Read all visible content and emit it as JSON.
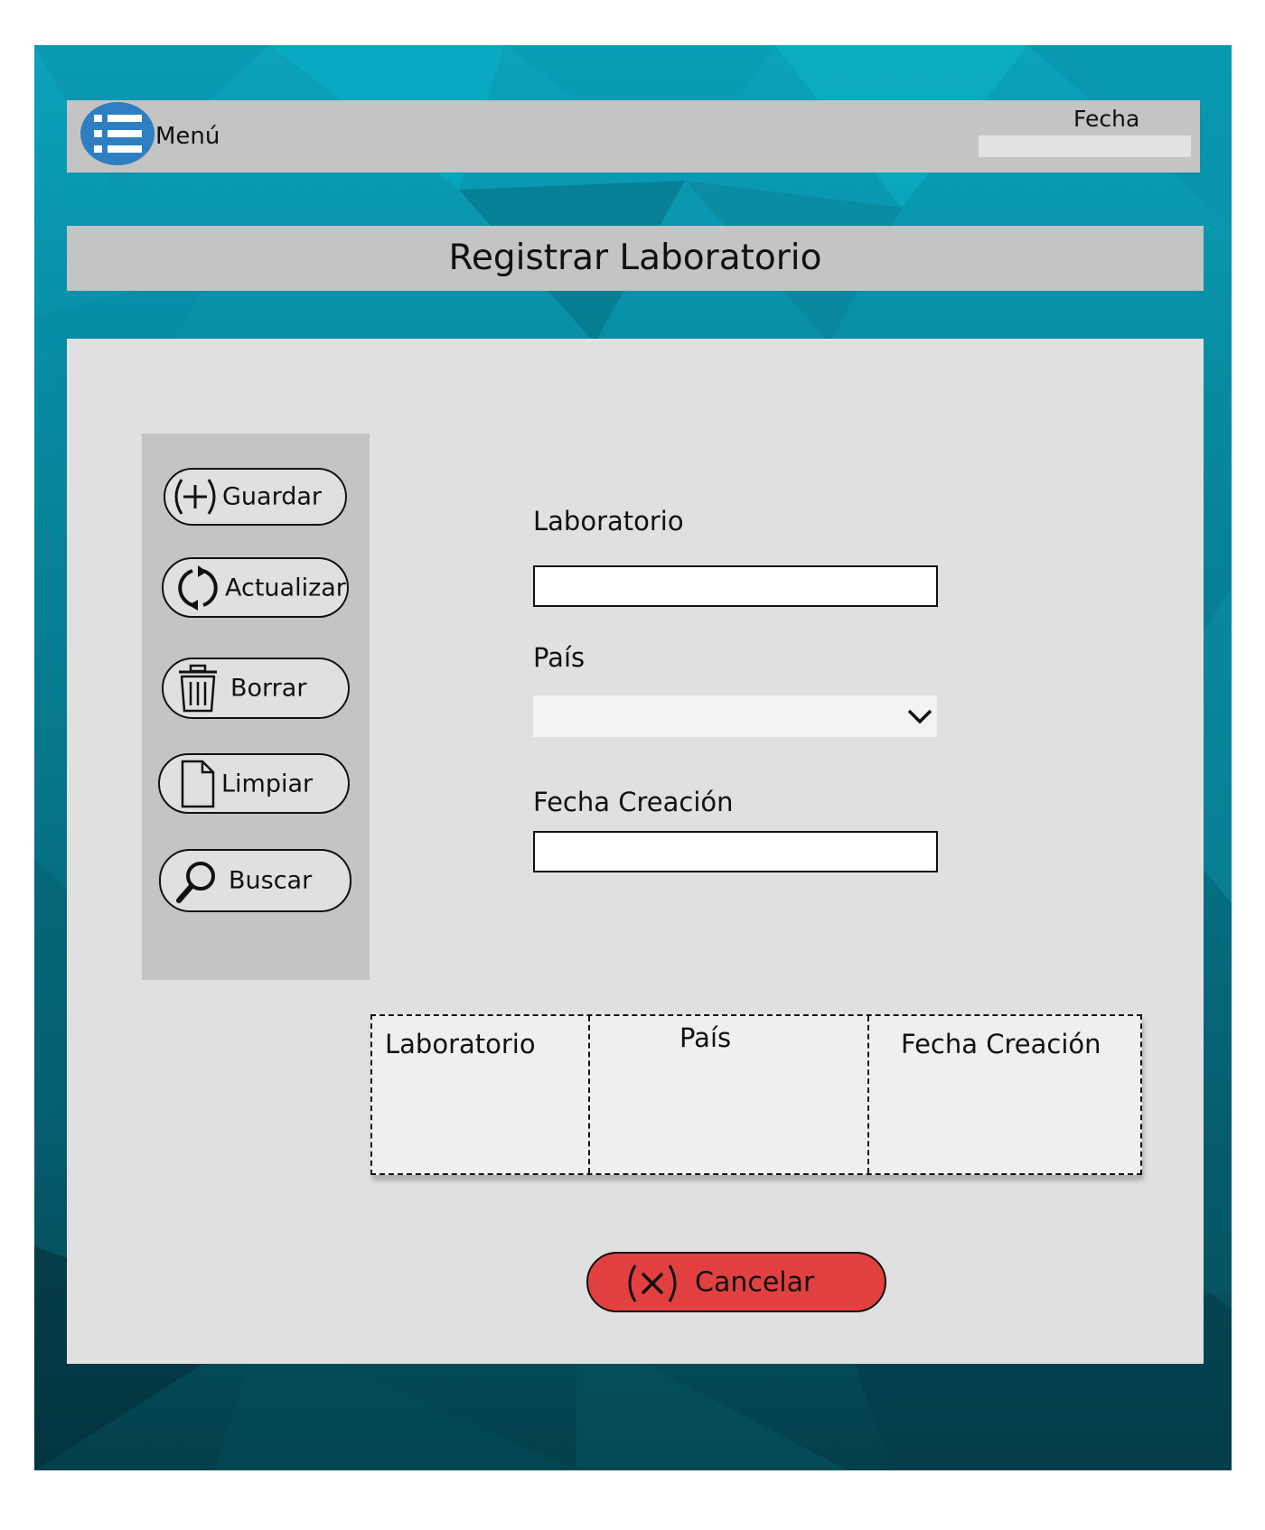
{
  "header": {
    "menu_icon": "list-icon",
    "menu_label": "Menú",
    "fecha_label": "Fecha",
    "fecha_value": ""
  },
  "page_title": "Registrar Laboratorio",
  "sidebar": {
    "buttons": [
      {
        "label": "Guardar",
        "icon": "plus-circle-icon"
      },
      {
        "label": "Actualizar",
        "icon": "refresh-icon"
      },
      {
        "label": "Borrar",
        "icon": "trash-icon"
      },
      {
        "label": "Limpiar",
        "icon": "document-icon"
      },
      {
        "label": "Buscar",
        "icon": "magnifier-icon"
      }
    ]
  },
  "form": {
    "laboratorio_label": "Laboratorio",
    "laboratorio_value": "",
    "pais_label": "País",
    "pais_value": "",
    "fecha_creacion_label": "Fecha Creación",
    "fecha_creacion_value": ""
  },
  "table": {
    "columns": [
      "Laboratorio",
      "País",
      "Fecha Creación"
    ],
    "rows": []
  },
  "cancel_button": {
    "label": "Cancelar",
    "icon": "x-circle-icon"
  },
  "colors": {
    "background_accent": "#078aa0",
    "bar_gray": "#c4c4c4",
    "panel_gray": "#e0e0e0",
    "menu_blue": "#2e7fc1",
    "cancel_red": "#e24040"
  }
}
